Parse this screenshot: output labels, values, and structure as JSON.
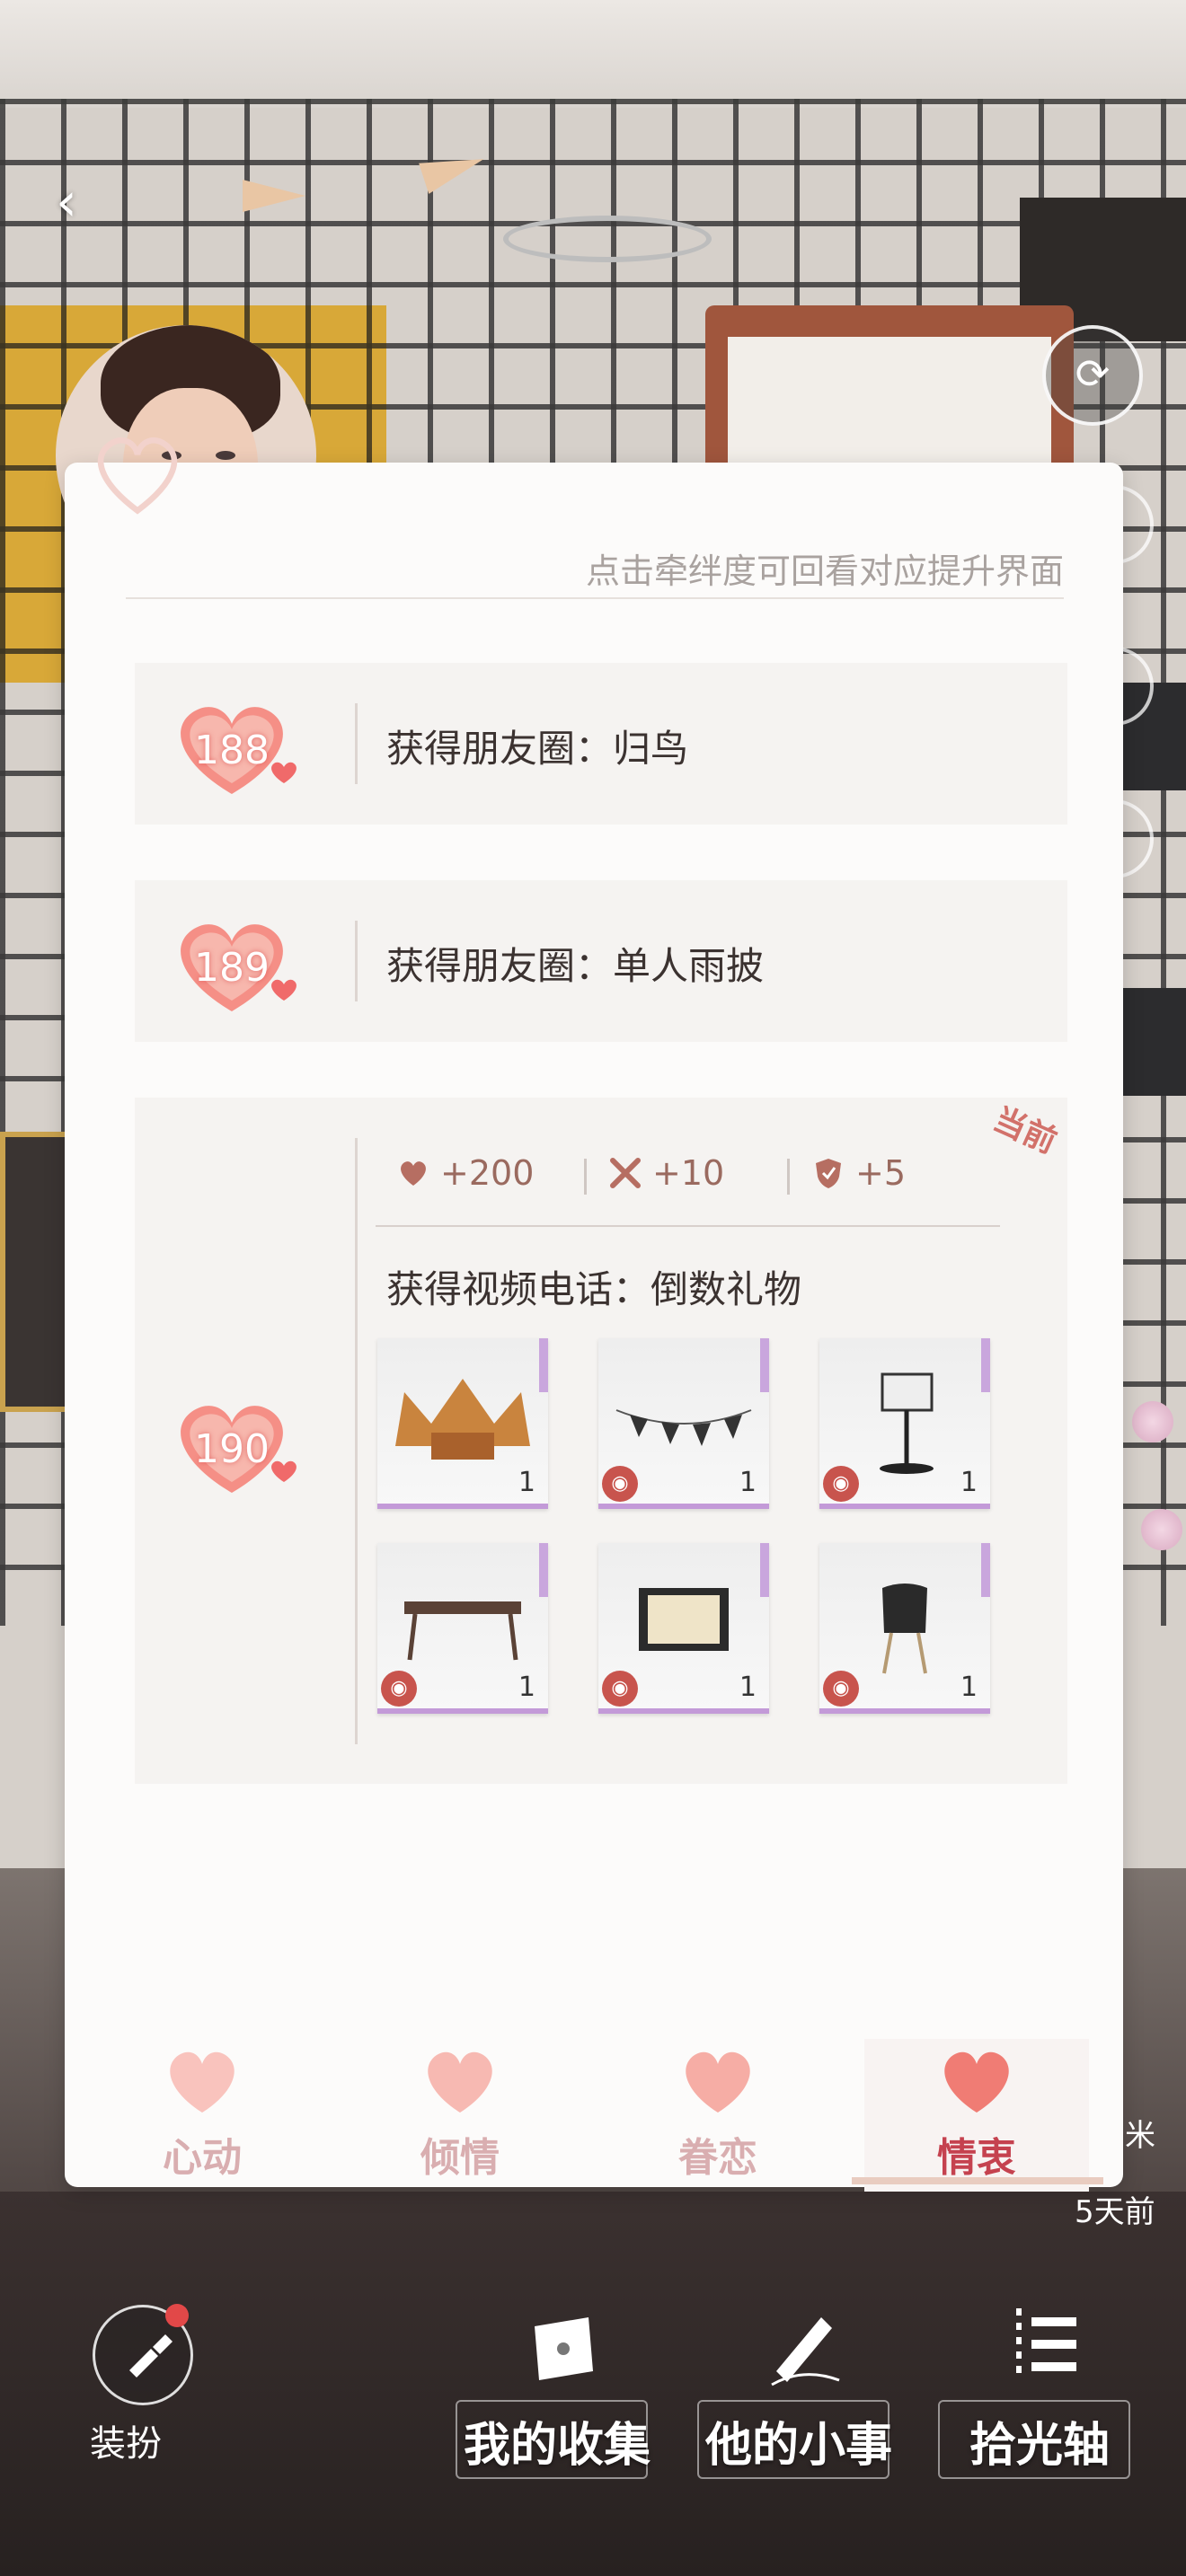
{
  "hint": "点击牵绊度可回看对应提升界面",
  "levels": [
    {
      "level": "188",
      "reward": "获得朋友圈：归鸟"
    },
    {
      "level": "189",
      "reward": "获得朋友圈：单人雨披"
    },
    {
      "level": "190",
      "reward": "获得视频电话：倒数礼物",
      "current_tag": "当前",
      "stats": [
        {
          "icon": "heart-icon",
          "value": "+200"
        },
        {
          "icon": "crossed-swords-icon",
          "value": "+10"
        },
        {
          "icon": "shield-icon",
          "value": "+5"
        }
      ],
      "items": [
        {
          "icon": "crown-icon",
          "qty": "1"
        },
        {
          "icon": "bunting-icon",
          "qty": "1"
        },
        {
          "icon": "basketball-hoop-icon",
          "qty": "1"
        },
        {
          "icon": "desk-icon",
          "qty": "1"
        },
        {
          "icon": "bulletin-board-icon",
          "qty": "1"
        },
        {
          "icon": "chair-icon",
          "qty": "1"
        }
      ]
    }
  ],
  "tabs": [
    {
      "label": "心动",
      "active": false
    },
    {
      "label": "倾情",
      "active": false
    },
    {
      "label": "眷恋",
      "active": false
    },
    {
      "label": "情衷",
      "active": true
    }
  ],
  "side": {
    "partial_label": "米",
    "time_ago": "5天前"
  },
  "dock": {
    "dress_label": "装扮",
    "items": [
      {
        "label": "我的收集",
        "icon": "envelope-icon"
      },
      {
        "label": "他的小事",
        "icon": "pen-icon"
      },
      {
        "label": "拾光轴",
        "icon": "timeline-icon"
      }
    ]
  },
  "colors": {
    "accent": "#c5424f",
    "badge": "#f07a7a",
    "panel": "#fcfbfa",
    "card": "#f5f3f1"
  }
}
